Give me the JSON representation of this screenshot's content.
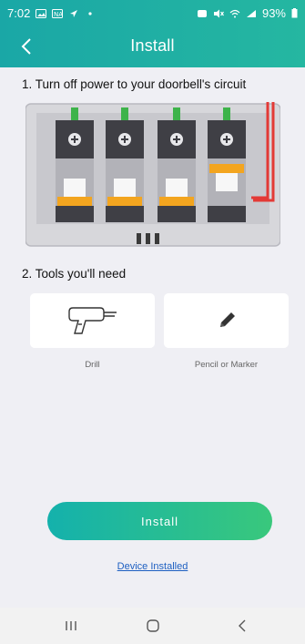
{
  "status": {
    "time": "7:02",
    "left_icons": [
      "image-icon",
      "notification-icon",
      "location-icon",
      "dot-icon"
    ],
    "right_icons": [
      "alarm-icon",
      "mute-icon",
      "wifi-icon",
      "signal-icon"
    ],
    "battery": "93%"
  },
  "header": {
    "title": "Install",
    "back_icon": "chevron-left-icon"
  },
  "steps": {
    "step1_title": "1. Turn off power to your doorbell's circuit",
    "step2_title": "2. Tools you'll need"
  },
  "tools": [
    {
      "label": "Drill",
      "icon": "drill-icon"
    },
    {
      "label": "Pencil or Marker",
      "icon": "pencil-icon"
    }
  ],
  "actions": {
    "install_label": "Install",
    "device_installed_label": "Device Installed"
  },
  "navigation": {
    "recents_icon": "recents-icon",
    "home_icon": "home-icon",
    "back_icon": "back-icon"
  },
  "colors": {
    "accent_start": "#14b1ac",
    "accent_end": "#39c87c",
    "link": "#1d5fc1",
    "breaker_handle": "#f3a51f",
    "breaker_tab_green": "#3db34a",
    "wire_red": "#e33a36"
  }
}
